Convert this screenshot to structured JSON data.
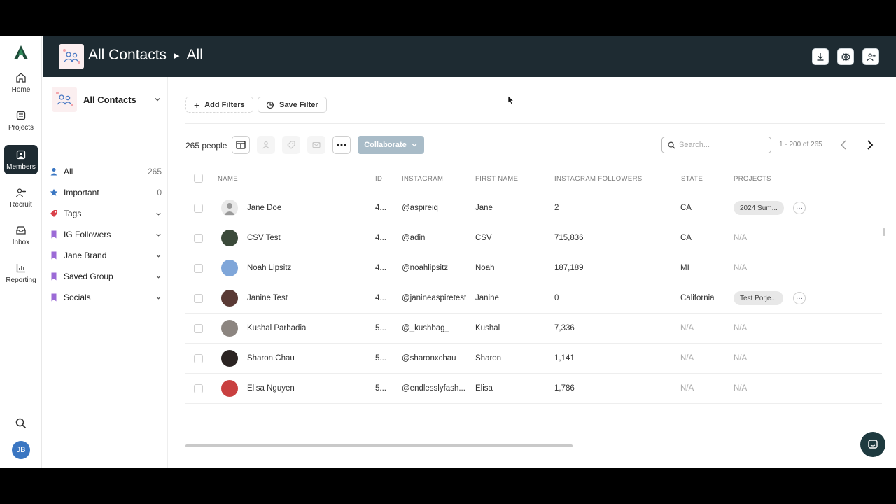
{
  "rail": {
    "items": [
      {
        "label": "Home",
        "icon": "home-icon"
      },
      {
        "label": "Projects",
        "icon": "projects-icon"
      },
      {
        "label": "Members",
        "icon": "members-icon",
        "active": true
      },
      {
        "label": "Recruit",
        "icon": "recruit-icon"
      },
      {
        "label": "Inbox",
        "icon": "inbox-icon"
      },
      {
        "label": "Reporting",
        "icon": "reporting-icon"
      }
    ],
    "avatar_initials": "JB"
  },
  "header": {
    "title": "All Contacts",
    "subtitle": "All",
    "actions": [
      "download-icon",
      "gear-icon",
      "add-user-icon"
    ]
  },
  "subnav": {
    "title": "All Contacts",
    "items": [
      {
        "label": "All",
        "count": "265",
        "icon": "person-icon",
        "color": "#3a76c2"
      },
      {
        "label": "Important",
        "count": "0",
        "icon": "star-icon",
        "color": "#3a76c2"
      },
      {
        "label": "Tags",
        "icon": "tag-icon",
        "color": "#d9414a",
        "expandable": true
      },
      {
        "label": "IG Followers",
        "icon": "bookmark-icon",
        "color": "#9b6ad6",
        "expandable": true
      },
      {
        "label": "Jane Brand",
        "icon": "bookmark-icon",
        "color": "#9b6ad6",
        "expandable": true
      },
      {
        "label": "Saved Group",
        "icon": "bookmark-icon",
        "color": "#9b6ad6",
        "expandable": true
      },
      {
        "label": "Socials",
        "icon": "bookmark-icon",
        "color": "#9b6ad6",
        "expandable": true
      }
    ]
  },
  "filters": {
    "add_label": "Add Filters",
    "save_label": "Save Filter"
  },
  "toolbar": {
    "count_label": "265 people",
    "collaborate_label": "Collaborate",
    "search_placeholder": "Search...",
    "pager_label": "1 - 200 of 265"
  },
  "table": {
    "columns": [
      "NAME",
      "ID",
      "INSTAGRAM",
      "FIRST NAME",
      "INSTAGRAM FOLLOWERS",
      "STATE",
      "PROJECTS"
    ],
    "rows": [
      {
        "name": "Jane Doe",
        "id": "4...",
        "instagram": "@aspireiq",
        "first": "Jane",
        "followers": "2",
        "state": "CA",
        "project": "2024 Sum...",
        "has_more": true,
        "avatar": "#d5d5d5"
      },
      {
        "name": "CSV Test",
        "id": "4...",
        "instagram": "@adin",
        "first": "CSV",
        "followers": "715,836",
        "state": "CA",
        "project": "N/A",
        "avatar": "#3b4a3a"
      },
      {
        "name": "Noah Lipsitz",
        "id": "4...",
        "instagram": "@noahlipsitz",
        "first": "Noah",
        "followers": "187,189",
        "state": "MI",
        "project": "N/A",
        "avatar": "#7fa6d9"
      },
      {
        "name": "Janine Test",
        "id": "4...",
        "instagram": "@janineaspiretest",
        "first": "Janine",
        "followers": "0",
        "state": "California",
        "project": "Test Porje...",
        "has_more": true,
        "avatar": "#5a3a35"
      },
      {
        "name": "Kushal Parbadia",
        "id": "5...",
        "instagram": "@_kushbag_",
        "first": "Kushal",
        "followers": "7,336",
        "state": "N/A",
        "project": "N/A",
        "avatar": "#8c8580"
      },
      {
        "name": "Sharon Chau",
        "id": "5...",
        "instagram": "@sharonxchau",
        "first": "Sharon",
        "followers": "1,141",
        "state": "N/A",
        "project": "N/A",
        "avatar": "#2b2422"
      },
      {
        "name": "Elisa Nguyen",
        "id": "5...",
        "instagram": "@endlesslyfash...",
        "first": "Elisa",
        "followers": "1,786",
        "state": "N/A",
        "project": "N/A",
        "avatar": "#c94040"
      }
    ]
  }
}
